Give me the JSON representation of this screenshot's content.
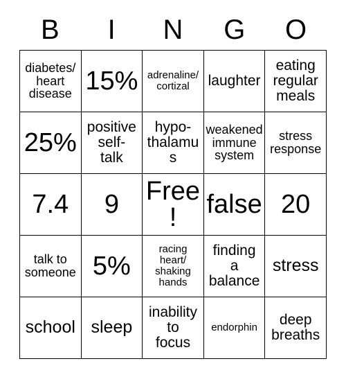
{
  "card": {
    "title": "BINGO",
    "header_letters": [
      "B",
      "I",
      "N",
      "G",
      "O"
    ],
    "free_space_label": "Free!",
    "colors": {
      "background": "#ffffff",
      "border": "#000000",
      "text": "#000000"
    },
    "rows": [
      [
        {
          "text": "diabetes/\nheart\ndisease",
          "size": "sm"
        },
        {
          "text": "15%",
          "size": "xxl"
        },
        {
          "text": "adrenaline/\ncortizal",
          "size": "xs"
        },
        {
          "text": "laughter",
          "size": "md"
        },
        {
          "text": "eating\nregular\nmeals",
          "size": "md"
        }
      ],
      [
        {
          "text": "25%",
          "size": "xxl"
        },
        {
          "text": "positive\nself-\ntalk",
          "size": "md"
        },
        {
          "text": "hypo-\nthalamus",
          "size": "md"
        },
        {
          "text": "weakened\nimmune\nsystem",
          "size": "sm"
        },
        {
          "text": "stress\nresponse",
          "size": "sm"
        }
      ],
      [
        {
          "text": "7.4",
          "size": "xxl"
        },
        {
          "text": "9",
          "size": "xxl"
        },
        {
          "text": "Free!",
          "size": "xxl"
        },
        {
          "text": "false",
          "size": "xxl"
        },
        {
          "text": "20",
          "size": "xxl"
        }
      ],
      [
        {
          "text": "talk to\nsomeone",
          "size": "sm"
        },
        {
          "text": "5%",
          "size": "xxl"
        },
        {
          "text": "racing\nheart/\nshaking\nhands",
          "size": "xs"
        },
        {
          "text": "finding\na\nbalance",
          "size": "md"
        },
        {
          "text": "stress",
          "size": "lg"
        }
      ],
      [
        {
          "text": "school",
          "size": "lg"
        },
        {
          "text": "sleep",
          "size": "lg"
        },
        {
          "text": "inability\nto\nfocus",
          "size": "md"
        },
        {
          "text": "endorphin",
          "size": "xs"
        },
        {
          "text": "deep\nbreaths",
          "size": "md"
        }
      ]
    ]
  }
}
